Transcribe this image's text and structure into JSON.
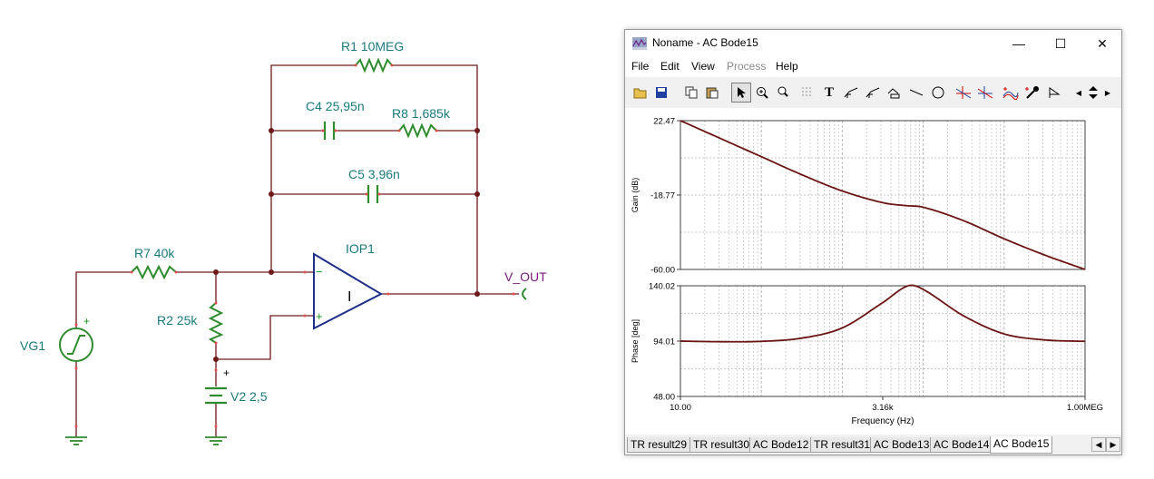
{
  "schematic": {
    "components": {
      "r1": "R1 10MEG",
      "c4": "C4 25,95n",
      "r8": "R8 1,685k",
      "c5": "C5 3,96n",
      "r7": "R7 40k",
      "r2": "R2 25k",
      "iop1": "IOP1",
      "vg1": "VG1",
      "v2": "V2 2,5",
      "vout": "V_OUT"
    },
    "opamp_symbol": "I",
    "plus": "+",
    "minus": "−"
  },
  "window": {
    "title": "Noname - AC Bode15",
    "controls": {
      "minimize": "—",
      "maximize": "☐",
      "close": "✕"
    }
  },
  "menu": [
    {
      "label": "File",
      "enabled": true
    },
    {
      "label": "Edit",
      "enabled": true
    },
    {
      "label": "View",
      "enabled": true
    },
    {
      "label": "Process",
      "enabled": false
    },
    {
      "label": "Help",
      "enabled": true
    }
  ],
  "toolbar": {
    "text_tool": "T"
  },
  "chart_data": {
    "type": "line",
    "x_axis": {
      "label": "Frequency (Hz)",
      "scale": "log",
      "range": [
        10,
        1000000
      ],
      "tick_labels": [
        "10.00",
        "3.16k",
        "1.00MEG"
      ],
      "tick_values": [
        10,
        3160,
        1000000
      ]
    },
    "panels": [
      {
        "ylabel": "Gain (dB)",
        "ylim": [
          -60.0,
          22.47
        ],
        "tick_labels": [
          "22.47",
          "-18.77",
          "-60.00"
        ],
        "series": [
          {
            "color": "#6b1414",
            "points": [
              [
                10,
                22.47
              ],
              [
                31.6,
                12.5
              ],
              [
                100,
                2.5
              ],
              [
                316,
                -7.5
              ],
              [
                1000,
                -16.5
              ],
              [
                3160,
                -23.0
              ],
              [
                6000,
                -24.6
              ],
              [
                10000,
                -25.5
              ],
              [
                31600,
                -33.0
              ],
              [
                100000,
                -43.0
              ],
              [
                316000,
                -52.0
              ],
              [
                1000000,
                -60.0
              ]
            ]
          }
        ]
      },
      {
        "ylabel": "Phase [deg]",
        "ylim": [
          48.0,
          140.02
        ],
        "tick_labels": [
          "140.02",
          "94.01",
          "48.00"
        ],
        "series": [
          {
            "color": "#6b1414",
            "points": [
              [
                10,
                94.0
              ],
              [
                31.6,
                93.5
              ],
              [
                100,
                93.8
              ],
              [
                316,
                96.5
              ],
              [
                1000,
                105.0
              ],
              [
                3160,
                126.0
              ],
              [
                6500,
                140.02
              ],
              [
                10000,
                137.0
              ],
              [
                31600,
                115.0
              ],
              [
                100000,
                100.0
              ],
              [
                316000,
                95.0
              ],
              [
                1000000,
                93.8
              ]
            ]
          }
        ]
      }
    ]
  },
  "tabs": [
    {
      "label": "TR result29",
      "active": false
    },
    {
      "label": "TR result30",
      "active": false
    },
    {
      "label": "AC Bode12",
      "active": false
    },
    {
      "label": "TR result31",
      "active": false
    },
    {
      "label": "AC Bode13",
      "active": false
    },
    {
      "label": "AC Bode14",
      "active": false
    },
    {
      "label": "AC Bode15",
      "active": true
    }
  ],
  "tab_scroll": {
    "left": "◀",
    "right": "▶"
  }
}
